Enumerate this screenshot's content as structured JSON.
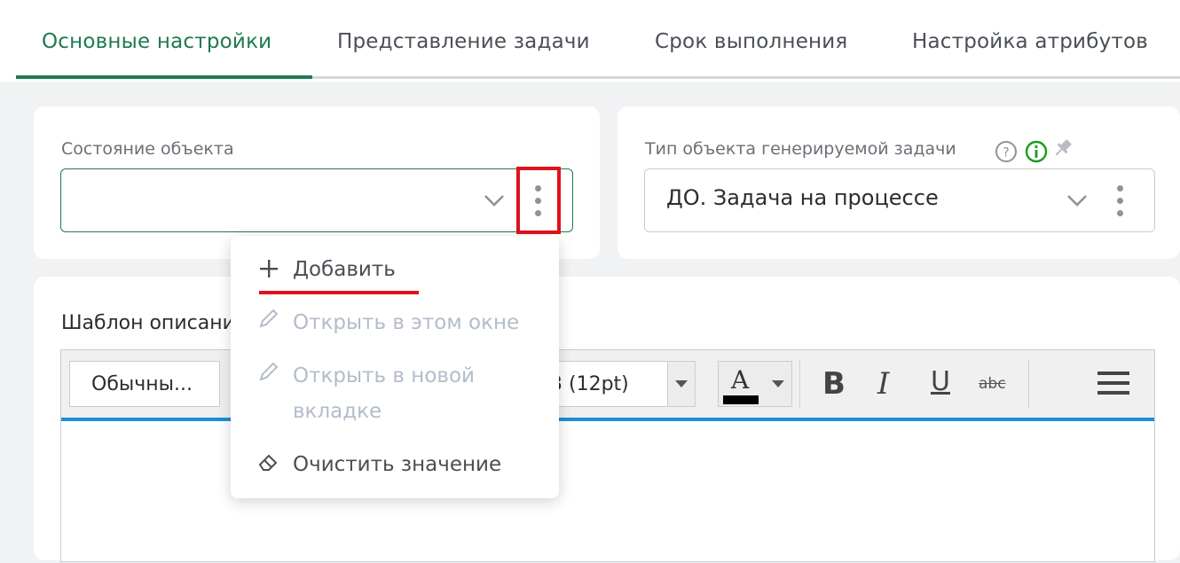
{
  "tabs": [
    {
      "label": "Основные настройки",
      "active": true
    },
    {
      "label": "Представление задачи",
      "active": false
    },
    {
      "label": "Срок выполнения",
      "active": false
    },
    {
      "label": "Настройка атрибутов",
      "active": false
    }
  ],
  "object_state": {
    "label": "Состояние объекта",
    "value": ""
  },
  "task_type": {
    "label": "Тип объекта генерируемой задачи",
    "value": "ДО. Задача на процессе",
    "icons": [
      "help-icon",
      "info-icon",
      "pin-icon"
    ]
  },
  "description": {
    "label": "Шаблон описания"
  },
  "editor_toolbar": {
    "style_value": "Обычны...",
    "size_value": "3 (12pt)",
    "buttons": [
      "font-color",
      "bold",
      "italic",
      "underline",
      "strikethrough",
      "menu"
    ],
    "bold_glyph": "B",
    "italic_glyph": "I",
    "underline_glyph": "U",
    "strike_glyph": "abc",
    "font_color_glyph": "A"
  },
  "context_menu": {
    "items": [
      {
        "label": "Добавить",
        "icon": "plus-icon",
        "enabled": true
      },
      {
        "label": "Открыть в этом окне",
        "icon": "pencil-icon",
        "enabled": false
      },
      {
        "label": "Открыть в новой",
        "label2": "вкладке",
        "icon": "pencil-icon",
        "enabled": false
      },
      {
        "label": "Очистить значение",
        "icon": "eraser-icon",
        "enabled": true
      }
    ]
  },
  "colors": {
    "accent": "#1e7a52",
    "highlight": "#e0121d",
    "editor_rule": "#1a8fd6",
    "disabled_text": "#b3bcca"
  }
}
